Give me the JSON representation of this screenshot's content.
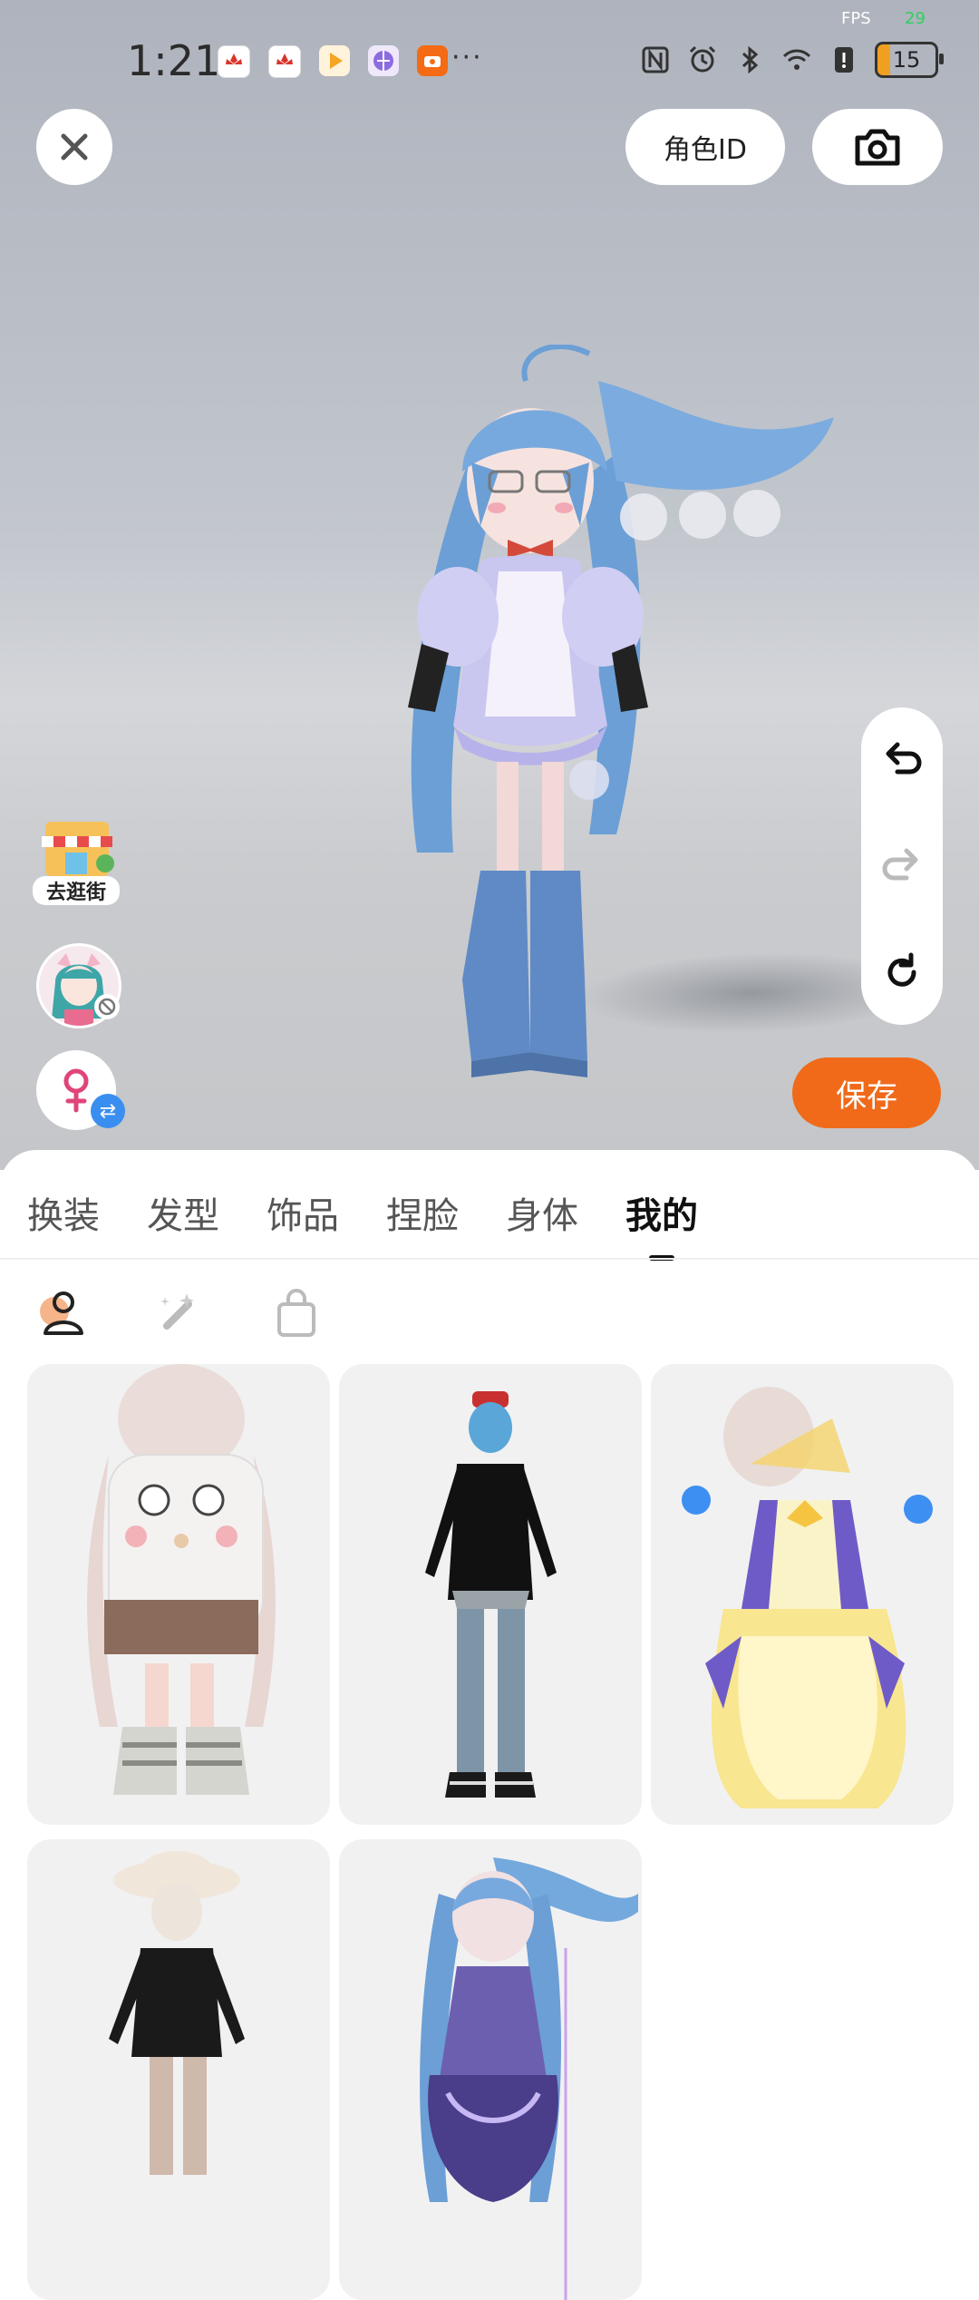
{
  "status_bar": {
    "time": "1:21",
    "notification_icons": [
      "huawei-icon",
      "huawei-icon",
      "video-app-icon",
      "browser-app-icon",
      "camera-app-icon"
    ],
    "more": "···",
    "system_icons": [
      "nfc-icon",
      "alarm-icon",
      "bluetooth-icon",
      "wifi-icon",
      "alert-icon"
    ],
    "battery": "15",
    "fps_label": "FPS",
    "fps_value": "29"
  },
  "top": {
    "role_id_label": "角色ID"
  },
  "side": {
    "shop_label": "去逛街"
  },
  "actions": {
    "save_label": "保存"
  },
  "tabs": [
    {
      "label": "换装"
    },
    {
      "label": "发型"
    },
    {
      "label": "饰品"
    },
    {
      "label": "捏脸"
    },
    {
      "label": "身体"
    },
    {
      "label": "我的",
      "active": true
    }
  ],
  "subtabs": [
    "person-icon",
    "magic-wand-icon",
    "shopping-bag-icon"
  ],
  "outfits": [
    {
      "name": "outfit-sponge-pillow"
    },
    {
      "name": "outfit-black-casual"
    },
    {
      "name": "outfit-yellow-magical-dress"
    },
    {
      "name": "outfit-white-hat-black"
    },
    {
      "name": "outfit-blue-hair-purple-dress"
    }
  ],
  "colors": {
    "accent": "#f06a1a",
    "swap_blue": "#3a8ef0",
    "gender_pink": "#e0457a"
  }
}
